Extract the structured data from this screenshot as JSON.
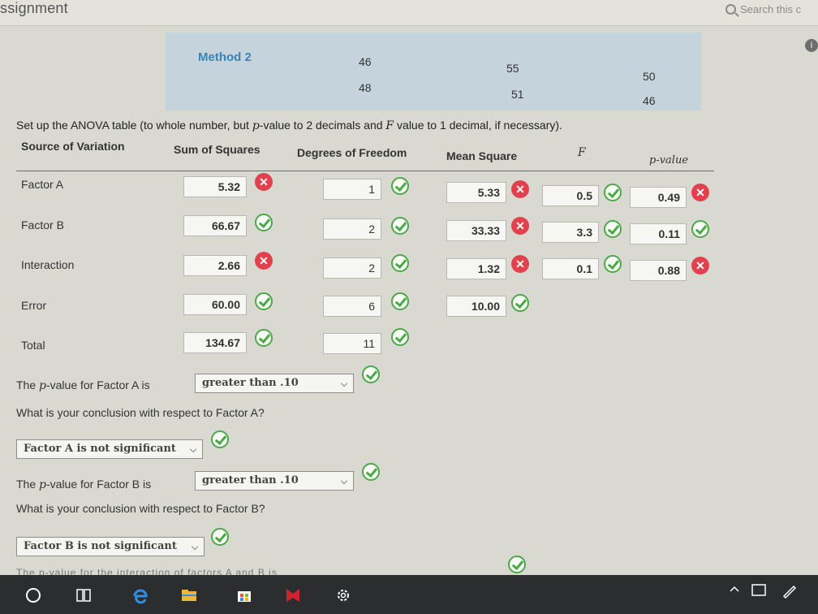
{
  "header": {
    "title": "ssignment",
    "search_placeholder": "Search this c"
  },
  "method_panel": {
    "label": "Method 2",
    "values": [
      "46",
      "55",
      "50",
      "48",
      "51",
      "46"
    ]
  },
  "instructions": {
    "pre": "Set up the ANOVA table (to whole number, but ",
    "p": "p",
    "mid": "-value to 2 decimals and ",
    "f": "F",
    "post": " value to 1 decimal, if necessary)."
  },
  "table": {
    "headers": [
      "Source of Variation",
      "Sum of Squares",
      "Degrees of Freedom",
      "Mean Square",
      "F",
      "p-value"
    ],
    "rows": [
      {
        "source": "Factor A",
        "ss": "5.32",
        "ss_ok": false,
        "df": "1",
        "df_ok": true,
        "ms": "5.33",
        "ms_ok": false,
        "f": "0.5",
        "f_ok": true,
        "p": "0.49",
        "p_ok": false
      },
      {
        "source": "Factor B",
        "ss": "66.67",
        "ss_ok": true,
        "df": "2",
        "df_ok": true,
        "ms": "33.33",
        "ms_ok": false,
        "f": "3.3",
        "f_ok": true,
        "p": "0.11",
        "p_ok": true
      },
      {
        "source": "Interaction",
        "ss": "2.66",
        "ss_ok": false,
        "df": "2",
        "df_ok": true,
        "ms": "1.32",
        "ms_ok": false,
        "f": "0.1",
        "f_ok": true,
        "p": "0.88",
        "p_ok": false
      },
      {
        "source": "Error",
        "ss": "60.00",
        "ss_ok": true,
        "df": "6",
        "df_ok": true,
        "ms": "10.00",
        "ms_ok": true
      },
      {
        "source": "Total",
        "ss": "134.67",
        "ss_ok": true,
        "df": "11",
        "df_ok": true
      }
    ]
  },
  "questions": {
    "q1_pre": "The ",
    "q1_p": "p",
    "q1_post": "-value for Factor A is",
    "q1_answer": "greater than .10",
    "q2": "What is your conclusion with respect to Factor A?",
    "q2_answer": "Factor A is not significant",
    "q3_pre": "The ",
    "q3_p": "p",
    "q3_post": "-value for Factor B is",
    "q3_answer": "greater than .10",
    "q4": "What is your conclusion with respect to Factor B?",
    "q4_answer": "Factor B is not significant",
    "cut_off": "The p-value for the interaction of factors A and B is"
  },
  "marks": {
    "wrong": "✕"
  },
  "colors": {
    "correct": "#4aa947",
    "incorrect": "#e3404e",
    "method_label": "#3a84b8"
  }
}
